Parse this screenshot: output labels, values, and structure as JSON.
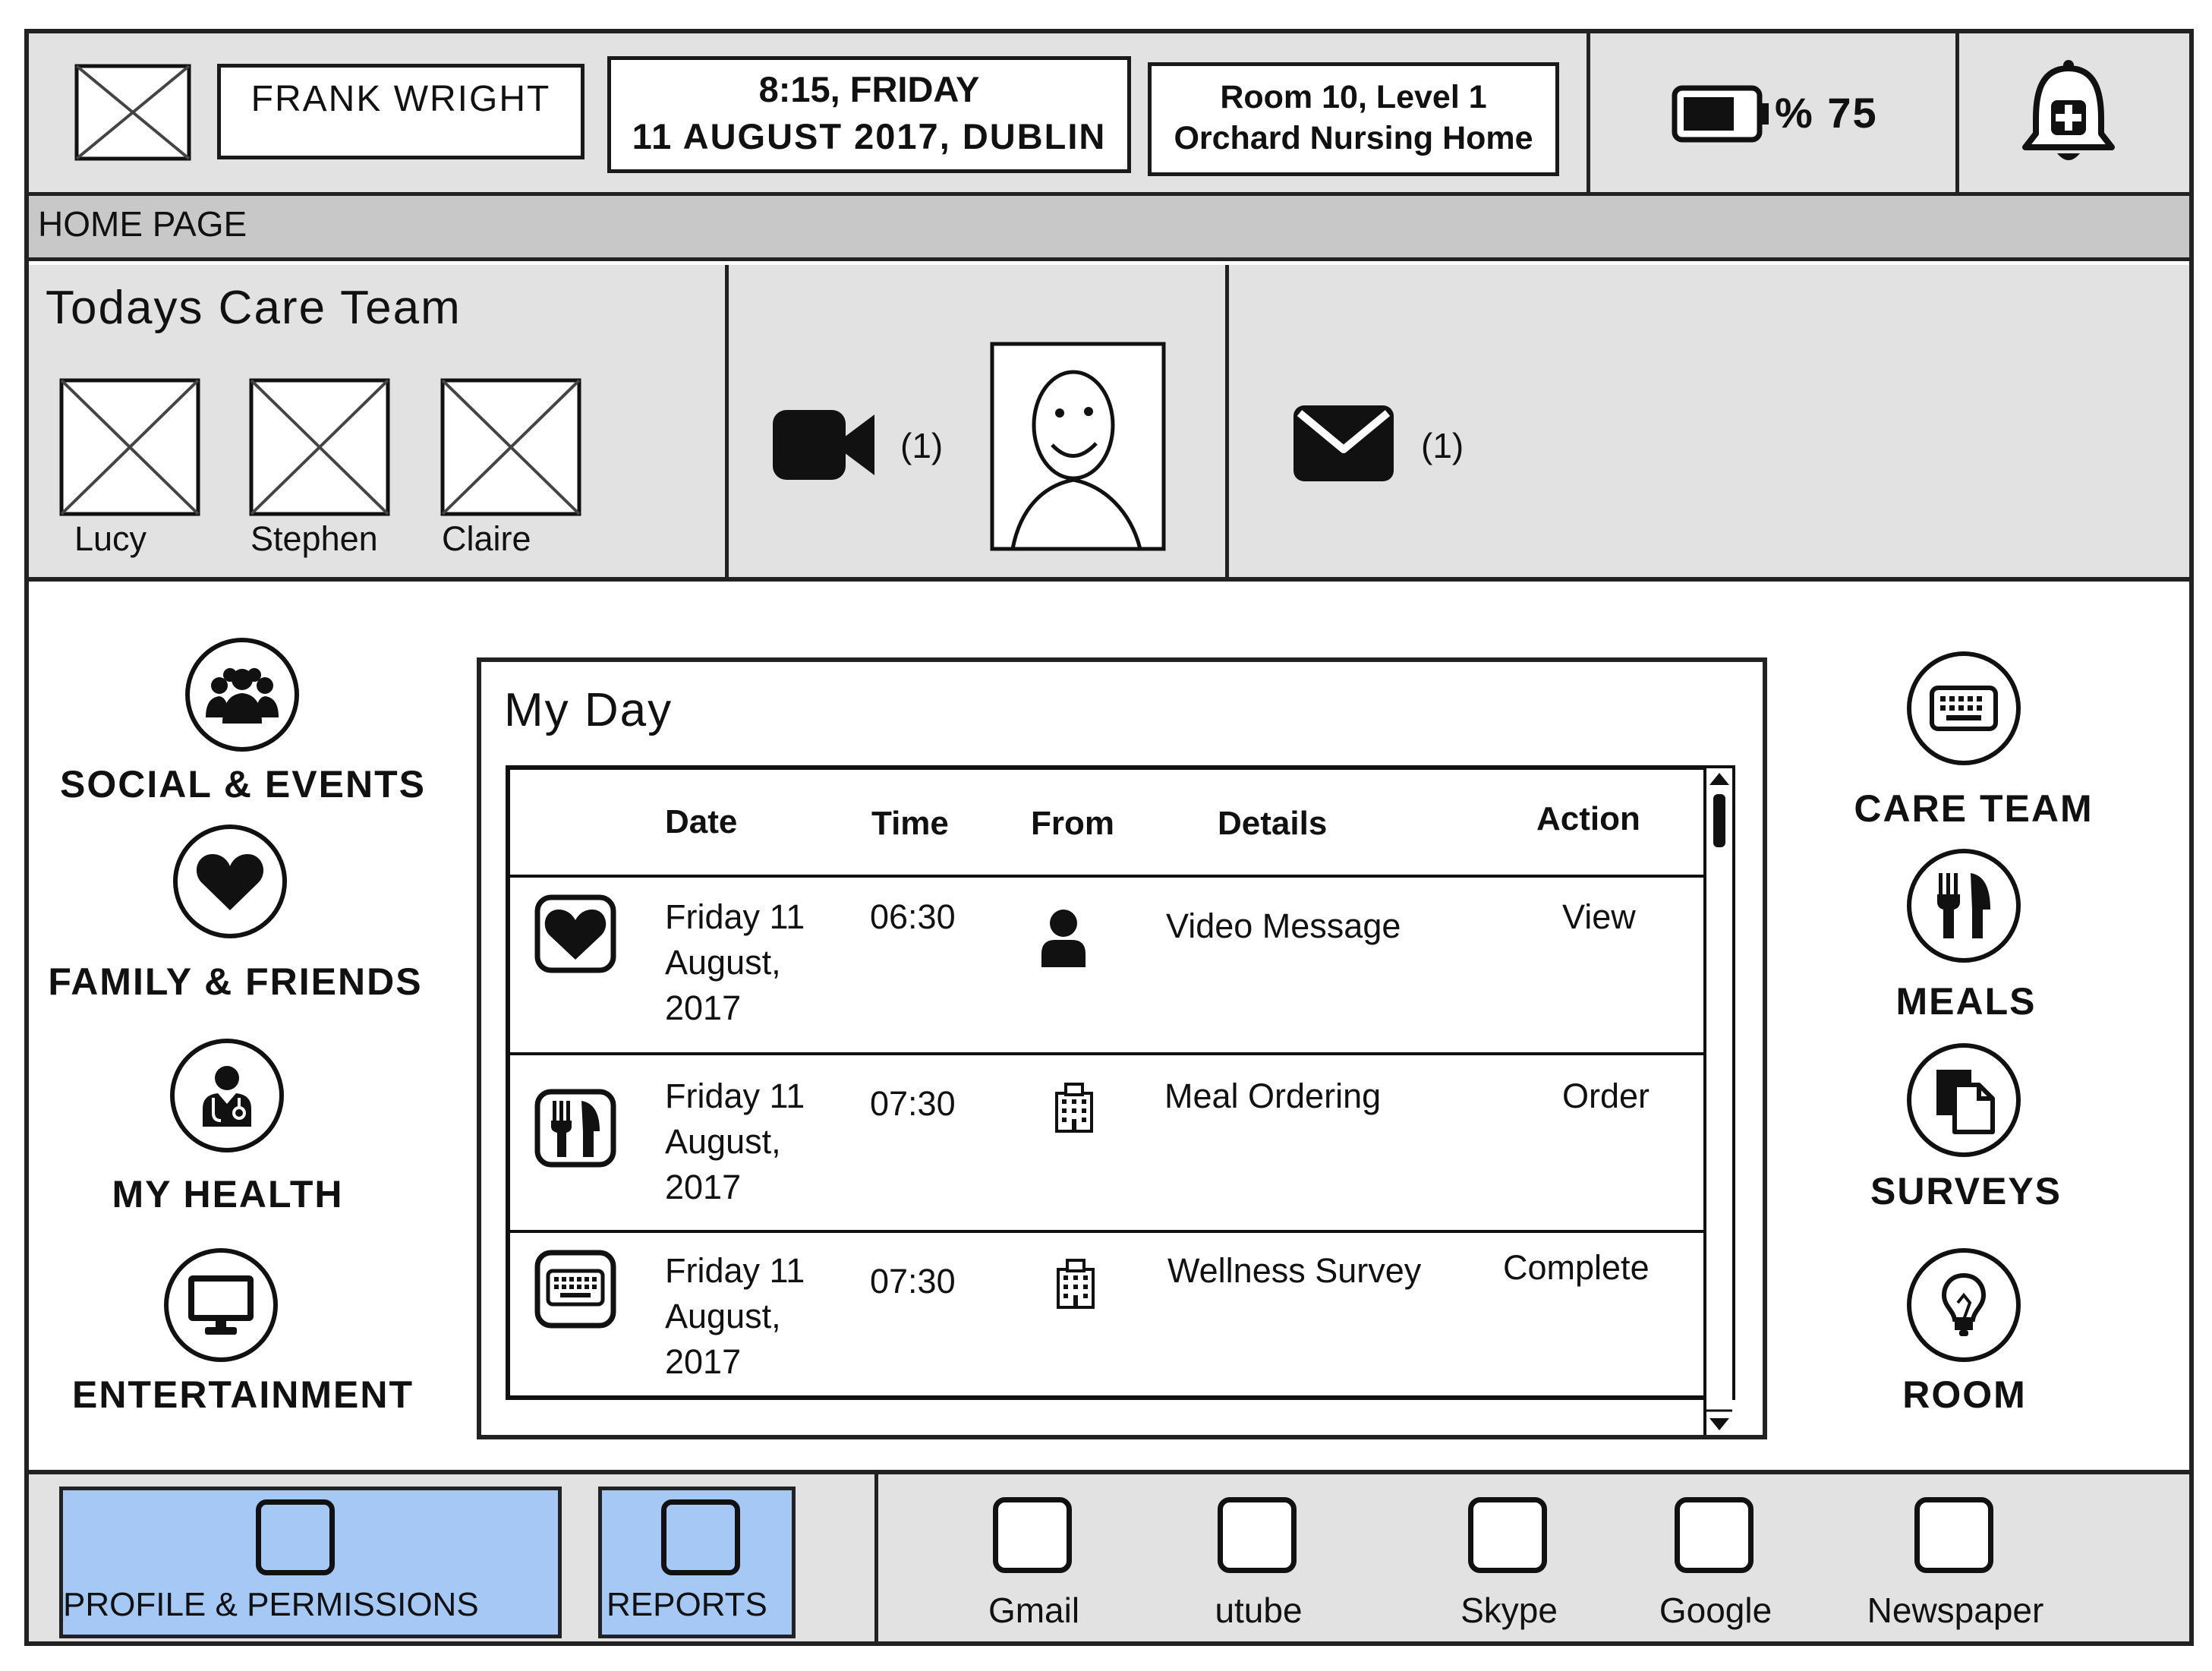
{
  "header": {
    "patient_name": "FRANK WRIGHT",
    "datetime_line1": "8:15, FRIDAY",
    "datetime_line2": "11 AUGUST 2017, DUBLIN",
    "location_line1": "Room 10, Level 1",
    "location_line2": "Orchard Nursing Home",
    "battery_text": "% 75",
    "battery_level": 0.75
  },
  "breadcrumb": "HOME PAGE",
  "care_team": {
    "title": "Todays Care Team",
    "members": [
      {
        "name": "Lucy"
      },
      {
        "name": "Stephen"
      },
      {
        "name": "Claire"
      }
    ]
  },
  "video": {
    "count": "(1)"
  },
  "mail": {
    "count": "(1)"
  },
  "left_nav": [
    {
      "label": "SOCIAL & EVENTS",
      "icon": "people-group-icon"
    },
    {
      "label": "FAMILY & FRIENDS",
      "icon": "heart-icon"
    },
    {
      "label": "MY HEALTH",
      "icon": "doctor-icon"
    },
    {
      "label": "ENTERTAINMENT",
      "icon": "monitor-icon"
    }
  ],
  "right_nav": [
    {
      "label": "CARE TEAM",
      "icon": "keyboard-icon"
    },
    {
      "label": "MEALS",
      "icon": "fork-knife-icon"
    },
    {
      "label": "SURVEYS",
      "icon": "documents-icon"
    },
    {
      "label": "ROOM",
      "icon": "lightbulb-icon"
    }
  ],
  "my_day": {
    "title": "My Day",
    "columns": [
      "Date",
      "Time",
      "From",
      "Details",
      "Action"
    ],
    "rows": [
      {
        "icon": "heart-icon",
        "date_l1": "Friday 11",
        "date_l2": "August,",
        "date_l3": "2017",
        "time": "06:30",
        "from_icon": "person-icon",
        "details": "Video Message",
        "action": "View"
      },
      {
        "icon": "fork-knife-icon",
        "date_l1": "Friday 11",
        "date_l2": "August,",
        "date_l3": "2017",
        "time": "07:30",
        "from_icon": "building-icon",
        "details": "Meal Ordering",
        "action": "Order"
      },
      {
        "icon": "keyboard-icon",
        "date_l1": "Friday 11",
        "date_l2": "August,",
        "date_l3": "2017",
        "time": "07:30",
        "from_icon": "building-icon",
        "details": "Wellness Survey",
        "action": "Complete"
      }
    ]
  },
  "footer": {
    "primary_buttons": [
      {
        "label": "PROFILE & PERMISSIONS"
      },
      {
        "label": "REPORTS"
      }
    ],
    "apps": [
      {
        "label": "Gmail"
      },
      {
        "label": "utube"
      },
      {
        "label": "Skype"
      },
      {
        "label": "Google"
      },
      {
        "label": "Newspaper"
      }
    ],
    "accent_color": "#a6c8f5"
  }
}
